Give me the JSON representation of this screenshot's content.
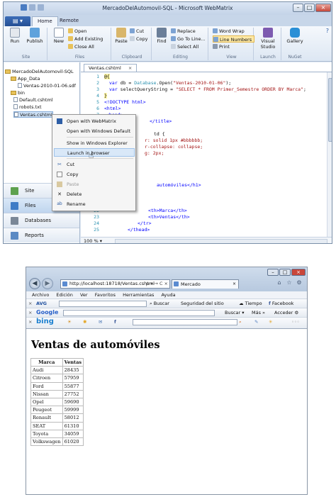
{
  "webmatrix": {
    "title": "MercadoDelAutomovil-SQL - Microsoft WebMatrix",
    "ribbon_tabs": [
      "Home",
      "Remote"
    ],
    "site_group": {
      "label": "Site",
      "run": "Run",
      "publish": "Publish"
    },
    "files_group": {
      "label": "Files",
      "new": "New",
      "open": "Open",
      "add_existing": "Add Existing",
      "close_all": "Close All"
    },
    "clipboard_group": {
      "label": "Clipboard",
      "paste": "Paste",
      "cut": "Cut",
      "copy": "Copy"
    },
    "editing_group": {
      "label": "Editing",
      "find": "Find",
      "replace": "Replace",
      "goto_line": "Go To Line...",
      "select_all": "Select All"
    },
    "view_group": {
      "label": "View",
      "word_wrap": "Word Wrap",
      "line_numbers": "Line Numbers",
      "print": "Print"
    },
    "launch_group": {
      "label": "Launch",
      "visual_studio": "Visual Studio"
    },
    "nuget_group": {
      "label": "NuGet",
      "gallery": "Gallery"
    },
    "tree": {
      "root": "MercadoDelAutomovil-SQL",
      "app_data": "App_Data",
      "sdf": "Ventas-2010-01-06.sdf",
      "bin": "bin",
      "default": "Default.cshtml",
      "robots": "robots.txt",
      "ventas": "Ventas.cshtml"
    },
    "workspaces": [
      "Site",
      "Files",
      "Databases",
      "Reports"
    ],
    "editor": {
      "tab": "Ventas.cshtml",
      "zoom": "100 %",
      "line_numbers": [
        "1",
        "2",
        "3",
        "4",
        "5",
        "6",
        "7",
        "8",
        "9",
        "10",
        "11",
        "12",
        "13",
        "14",
        "15",
        "16",
        "17",
        "18",
        "19",
        "20",
        "21",
        "22",
        "23",
        "24",
        "25"
      ],
      "l1": "@{",
      "l2a": "var",
      "l2b": " db = ",
      "l2c": "Database",
      "l2d": ".Open(",
      "l2e": "\"Ventas-2010-01-06\"",
      "l2f": ");",
      "l3a": "var",
      "l3b": " selectQueryString = ",
      "l3c": "\"SELECT * FROM Primer_Semestre ORDER BY Marca\"",
      "l3d": ";",
      "l4": "}",
      "l5": "<!DOCTYPE html>",
      "l6": "<html>",
      "l7": "<head>",
      "l8": "</title>",
      "l10": "td {",
      "l11": "r: solid 1px #bbbbbb;",
      "l12": "r-collapse: collapse;",
      "l13": "g: 2px;",
      "l17": "automóviles</h1>",
      "l22": "<th>Marca</th>",
      "l23": "<th>Ventas</th>",
      "l24": "</tr>",
      "l25": "</thead>"
    },
    "context_menu": {
      "open_webmatrix": "Open with WebMatrix",
      "open_default": "Open with Windows Default",
      "show_explorer": "Show in Windows Explorer",
      "launch_browser": "Launch in browser",
      "cut": "Cut",
      "copy": "Copy",
      "paste": "Paste",
      "delete": "Delete",
      "rename": "Rename"
    }
  },
  "browser": {
    "address": "http://localhost:18718/Ventas.cshtml",
    "address_actions": "ρ ▾ → C ×",
    "tab_title": "Mercado",
    "menu": [
      "Archivo",
      "Edición",
      "Ver",
      "Favoritos",
      "Herramientas",
      "Ayuda"
    ],
    "avg_bar": {
      "brand": "AVG",
      "search": "Buscar",
      "safety": "Seguridad del sitio",
      "weather": "Tiempo",
      "facebook": "Facebook"
    },
    "google_bar": {
      "brand": "Google",
      "search": "Buscar",
      "more": "Más »",
      "signin": "Acceder"
    },
    "bing_bar": {
      "brand": "bing",
      "more": "◦◦◦"
    },
    "page": {
      "heading": "Ventas de automóviles",
      "headers": [
        "Marca",
        "Ventas"
      ],
      "rows": [
        [
          "Audi",
          "28435"
        ],
        [
          "Citroen",
          "57959"
        ],
        [
          "Ford",
          "55877"
        ],
        [
          "Nissan",
          "27752"
        ],
        [
          "Opel",
          "59690"
        ],
        [
          "Peugeot",
          "59999"
        ],
        [
          "Renault",
          "58012"
        ],
        [
          "SEAT",
          "61310"
        ],
        [
          "Toyota",
          "34059"
        ],
        [
          "Volkswagen",
          "61020"
        ]
      ]
    }
  },
  "colors": {
    "ribbon_blue": "#2d5ea6",
    "link_blue": "#2b91af",
    "code_string": "#a31515",
    "keyword": "#0000ff"
  },
  "icons": [
    "run-icon",
    "publish-icon",
    "new-icon",
    "open-icon",
    "paste-icon",
    "find-icon",
    "visual-studio-icon",
    "gallery-icon",
    "folder-icon",
    "file-icon",
    "site-icon",
    "files-icon",
    "databases-icon",
    "reports-icon",
    "cut-icon",
    "copy-icon",
    "paste-icon",
    "delete-icon",
    "rename-icon",
    "webmatrix-icon",
    "back-icon",
    "forward-icon",
    "home-icon",
    "star-icon",
    "gear-icon",
    "close-icon"
  ]
}
